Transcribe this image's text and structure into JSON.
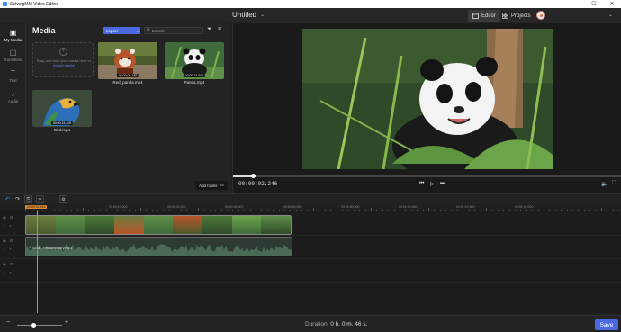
{
  "window": {
    "title": "SolveigMM Video Editor",
    "controls": {
      "minimize": "—",
      "maximize": "☐",
      "close": "✕"
    }
  },
  "header": {
    "project_title": "Untitled",
    "editor_label": "Editor",
    "projects_label": "Projects"
  },
  "rail": {
    "items": [
      {
        "label": "My Media",
        "icon": "media-icon",
        "glyph": "▣",
        "active": true
      },
      {
        "label": "Transitions",
        "icon": "transitions-icon",
        "glyph": "◫",
        "active": false
      },
      {
        "label": "Text",
        "icon": "text-icon",
        "glyph": "T",
        "active": false
      },
      {
        "label": "Audio",
        "icon": "audio-icon",
        "glyph": "♪",
        "active": false
      }
    ]
  },
  "media": {
    "title": "Media",
    "import_label": "Import",
    "search_placeholder": "Search",
    "dropzone_text": "Drag and drop your media here or",
    "dropzone_link": "import media",
    "add_folder_label": "Add folder",
    "items": [
      {
        "name": "Red_panda.mp4",
        "duration": "00:00:06.140"
      },
      {
        "name": "Panda.mp4",
        "duration": "00:00:24.600"
      },
      {
        "name": "Bird.mp4",
        "duration": "00:00:15.400"
      }
    ]
  },
  "preview": {
    "timecode": "00:00:02.246",
    "progress": 0.05
  },
  "timeline": {
    "playhead_time": "00:00:02.246",
    "ruler_labels": [
      "00:00:10.000",
      "00:00:20.000",
      "00:00:30.000",
      "00:00:40.000",
      "00:00:50.000",
      "00:01:00.000",
      "00:01:10.000",
      "00:01:20.000"
    ],
    "video_clip": "Red_panda.mp4",
    "audio_clip": "Sofa - Extraordinary.mp3"
  },
  "bottom": {
    "duration_label": "Duration:",
    "duration_value": "0 h. 0 m. 46 s.",
    "save_label": "Save",
    "zoom_level": 0.35
  },
  "colors": {
    "accent": "#4a69e0",
    "playhead": "#e08a2c",
    "background": "#1f1f1f"
  }
}
